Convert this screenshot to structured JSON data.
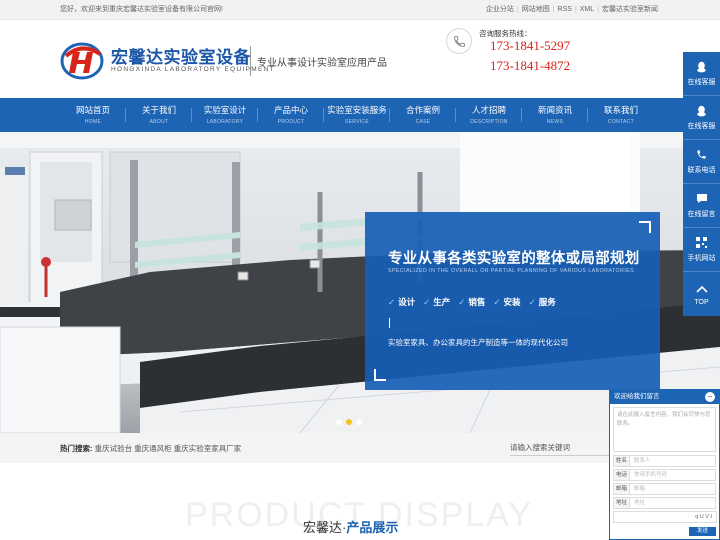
{
  "topbar": {
    "welcome": "您好，欢迎来到重庆宏馨达实验室设备有限公司官网!",
    "links": [
      "企业分站",
      "网站地图",
      "RSS",
      "XML",
      "宏馨达实验室新闻"
    ]
  },
  "header": {
    "brand_cn": "宏馨达实验室设备",
    "brand_en": "HONGXINDA LABORATORY EQUIPMENT",
    "slogan": "专业从事设计实验室应用产品",
    "hotline_label": "咨询服务热线：",
    "phone1": "173-1841-5297",
    "phone2": "173-1841-4872"
  },
  "nav": [
    {
      "cn": "网站首页",
      "en": "HOME"
    },
    {
      "cn": "关于我们",
      "en": "ABOUT"
    },
    {
      "cn": "实验室设计",
      "en": "LABORATORY"
    },
    {
      "cn": "产品中心",
      "en": "PRODUCT"
    },
    {
      "cn": "实验室安装服务",
      "en": "SERVICE"
    },
    {
      "cn": "合作案例",
      "en": "CASE"
    },
    {
      "cn": "人才招聘",
      "en": "DESCRIPTION"
    },
    {
      "cn": "新闻资讯",
      "en": "NEWS"
    },
    {
      "cn": "联系我们",
      "en": "CONTACT"
    }
  ],
  "banner": {
    "headline": "专业从事各类实验室的整体或局部规划",
    "subline": "SPECIALIZED IN THE OVERALL OR PARTIAL PLANNING OF VARIOUS LABORATORIES",
    "tags": [
      "设计",
      "生产",
      "销售",
      "安装",
      "服务"
    ],
    "description": "实验室家具、办公家具的生产制造等一体的现代化公司",
    "slides": 3,
    "active_slide": 2
  },
  "search": {
    "hot_label": "热门搜索:",
    "hot_terms": [
      "重庆试验台",
      "重庆通风柜",
      "重庆实验室家具厂家"
    ],
    "placeholder": "请输入搜索关键词"
  },
  "products": {
    "bg_text": "PRODUCT DISPLAY",
    "title_a": "宏馨达·",
    "title_b": "产品展示"
  },
  "sidebar": [
    {
      "label": "在线客服",
      "icon": "qq-icon"
    },
    {
      "label": "在线客服",
      "icon": "qq-icon"
    },
    {
      "label": "联系电话",
      "icon": "phone-icon"
    },
    {
      "label": "在线留言",
      "icon": "message-icon"
    },
    {
      "label": "手机网站",
      "icon": "qrcode-icon"
    },
    {
      "label": "TOP",
      "icon": "arrow-up-icon"
    }
  ],
  "chat": {
    "title": "欢迎给我们留言",
    "message_placeholder": "请在此输入留言内容，我们会尽快与您联系。",
    "fields": [
      {
        "label": "姓名",
        "placeholder": "联系人"
      },
      {
        "label": "电话",
        "placeholder": "常用手机号码"
      },
      {
        "label": "邮箱",
        "placeholder": "邮箱"
      },
      {
        "label": "地址",
        "placeholder": "地址"
      }
    ],
    "captcha": "q U V t",
    "send": "发送"
  },
  "colors": {
    "brand_blue": "#1e64b4",
    "phone_red": "#d9241c",
    "active_dot": "#f3c21a"
  }
}
